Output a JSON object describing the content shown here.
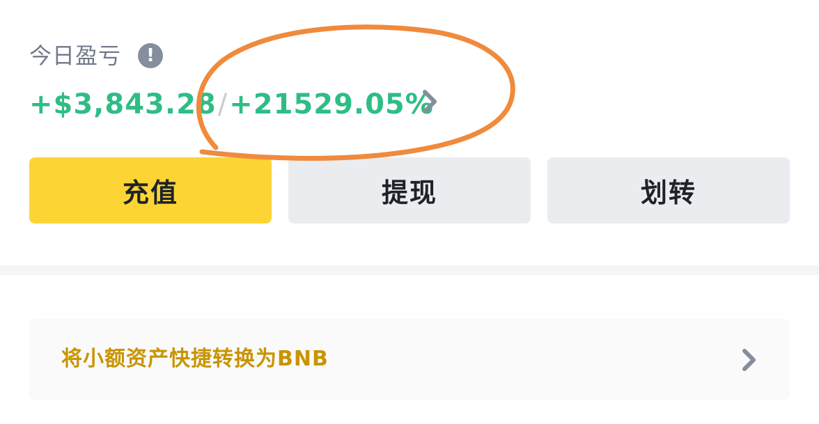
{
  "pnl": {
    "label": "今日盈亏",
    "info_icon": "!",
    "amount": "+$3,843.28",
    "separator": "/",
    "percent": "+21529.05%"
  },
  "actions": {
    "deposit_label": "充值",
    "withdraw_label": "提现",
    "transfer_label": "划转"
  },
  "convert": {
    "label": "将小额资产快捷转换为BNB"
  },
  "colors": {
    "positive": "#2ebd85",
    "primary_button": "#fcd535",
    "secondary_button": "#eaecef",
    "link_text": "#c99400",
    "annotation": "#f08a3c"
  },
  "icons": {
    "info": "info-icon",
    "chevron": "chevron-right-icon"
  }
}
